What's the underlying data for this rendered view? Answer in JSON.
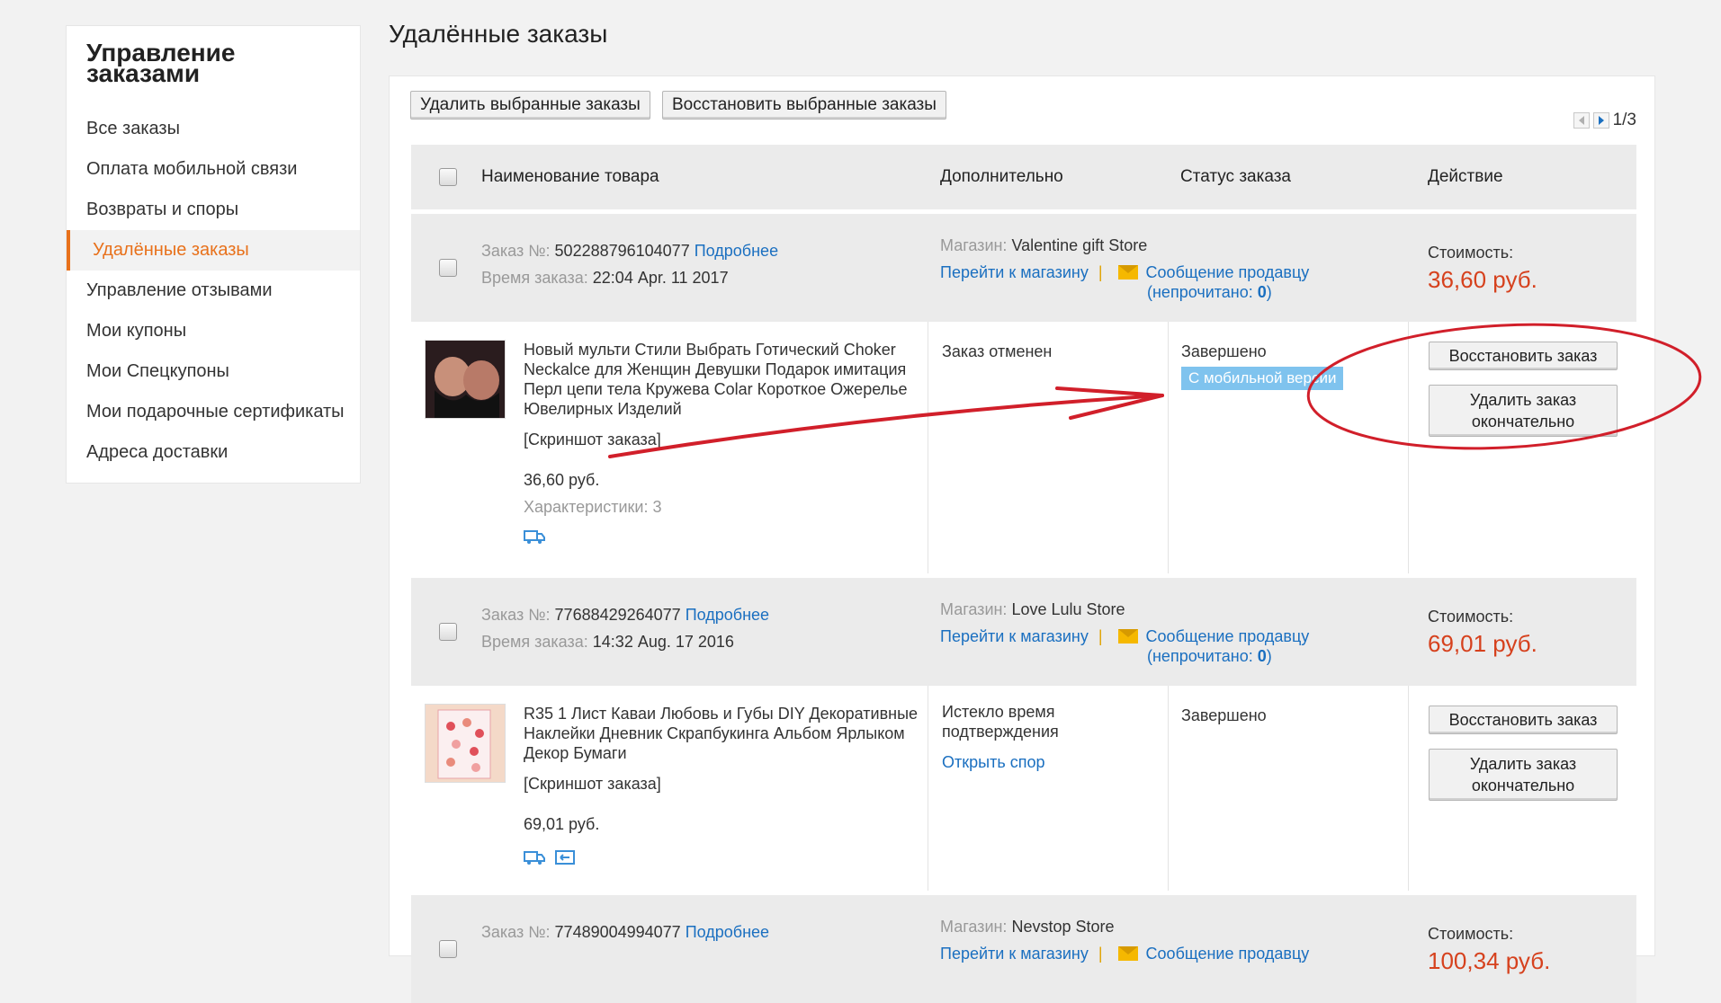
{
  "sidebar": {
    "title": "Управление заказами",
    "items": [
      {
        "label": "Все заказы"
      },
      {
        "label": "Оплата мобильной связи"
      },
      {
        "label": "Возвраты и споры"
      },
      {
        "label": "Удалённые заказы",
        "active": true
      },
      {
        "label": "Управление отзывами"
      },
      {
        "label": "Мои купоны"
      },
      {
        "label": "Мои Спецкупоны"
      },
      {
        "label": "Мои подарочные сертификаты"
      },
      {
        "label": "Адреса доставки"
      }
    ]
  },
  "page": {
    "title": "Удалённые заказы",
    "delete_selected": "Удалить выбранные заказы",
    "restore_selected": "Восстановить выбранные заказы",
    "pager": "1/3"
  },
  "table": {
    "col_product": "Наименование товара",
    "col_extra": "Дополнительно",
    "col_status": "Статус заказа",
    "col_action": "Действие"
  },
  "orders": [
    {
      "number_label": "Заказ №:",
      "number": "502288796104077",
      "details": "Подробнее",
      "time_label": "Время заказа:",
      "time": "22:04 Apr. 11 2017",
      "store_label": "Магазин:",
      "store": "Valentine gift Store",
      "go_store": "Перейти к магазину",
      "sep": "|",
      "message": "Сообщение продавцу",
      "unread_open": "(непрочитано: ",
      "unread_count": "0",
      "unread_close": ")",
      "cost_label": "Стоимость:",
      "cost": "36,60 руб.",
      "product": "Новый мульти Стили Выбрать Готический Choker Neckalce для Женщин Девушки Подарок имитация Перл цепи тела Кружева Colar Короткое Ожерелье Ювелирных Изделий",
      "snapshot": "[Скриншот заказа]",
      "price": "36,60 руб.",
      "specs": "Характеристики: 3",
      "extra": "Заказ отменен",
      "status": "Завершено",
      "status_tag": "С мобильной версии",
      "restore": "Восстановить заказ",
      "delete": "Удалить заказ окончательно"
    },
    {
      "number_label": "Заказ №:",
      "number": "77688429264077",
      "details": "Подробнее",
      "time_label": "Время заказа:",
      "time": "14:32 Aug. 17 2016",
      "store_label": "Магазин:",
      "store": "Love Lulu Store",
      "go_store": "Перейти к магазину",
      "sep": "|",
      "message": "Сообщение продавцу",
      "unread_open": "(непрочитано: ",
      "unread_count": "0",
      "unread_close": ")",
      "cost_label": "Стоимость:",
      "cost": "69,01 руб.",
      "product": "R35 1 Лист Каваи Любовь и Губы DIY Декоративные Наклейки Дневник Скрапбукинга Альбом Ярлыком Декор Бумаги",
      "snapshot": "[Скриншот заказа]",
      "price": "69,01 руб.",
      "extra": "Истекло время подтверждения",
      "dispute": "Открыть спор",
      "status": "Завершено",
      "restore": "Восстановить заказ",
      "delete": "Удалить заказ окончательно"
    },
    {
      "number_label": "Заказ №:",
      "number": "77489004994077",
      "details": "Подробнее",
      "store_label": "Магазин:",
      "store": "Nevstop Store",
      "go_store": "Перейти к магазину",
      "sep": "|",
      "message": "Сообщение продавцу",
      "cost_label": "Стоимость:",
      "cost": "100,34 руб."
    }
  ],
  "colors": {
    "accent": "#e8711b",
    "link": "#1a6fc0",
    "price": "#d6411d",
    "tag": "#7fc3ee",
    "annotation": "#d11f2a"
  },
  "icons": [
    "truck-icon",
    "return-icon",
    "envelope-icon",
    "chevron-left-icon",
    "chevron-right-icon"
  ]
}
